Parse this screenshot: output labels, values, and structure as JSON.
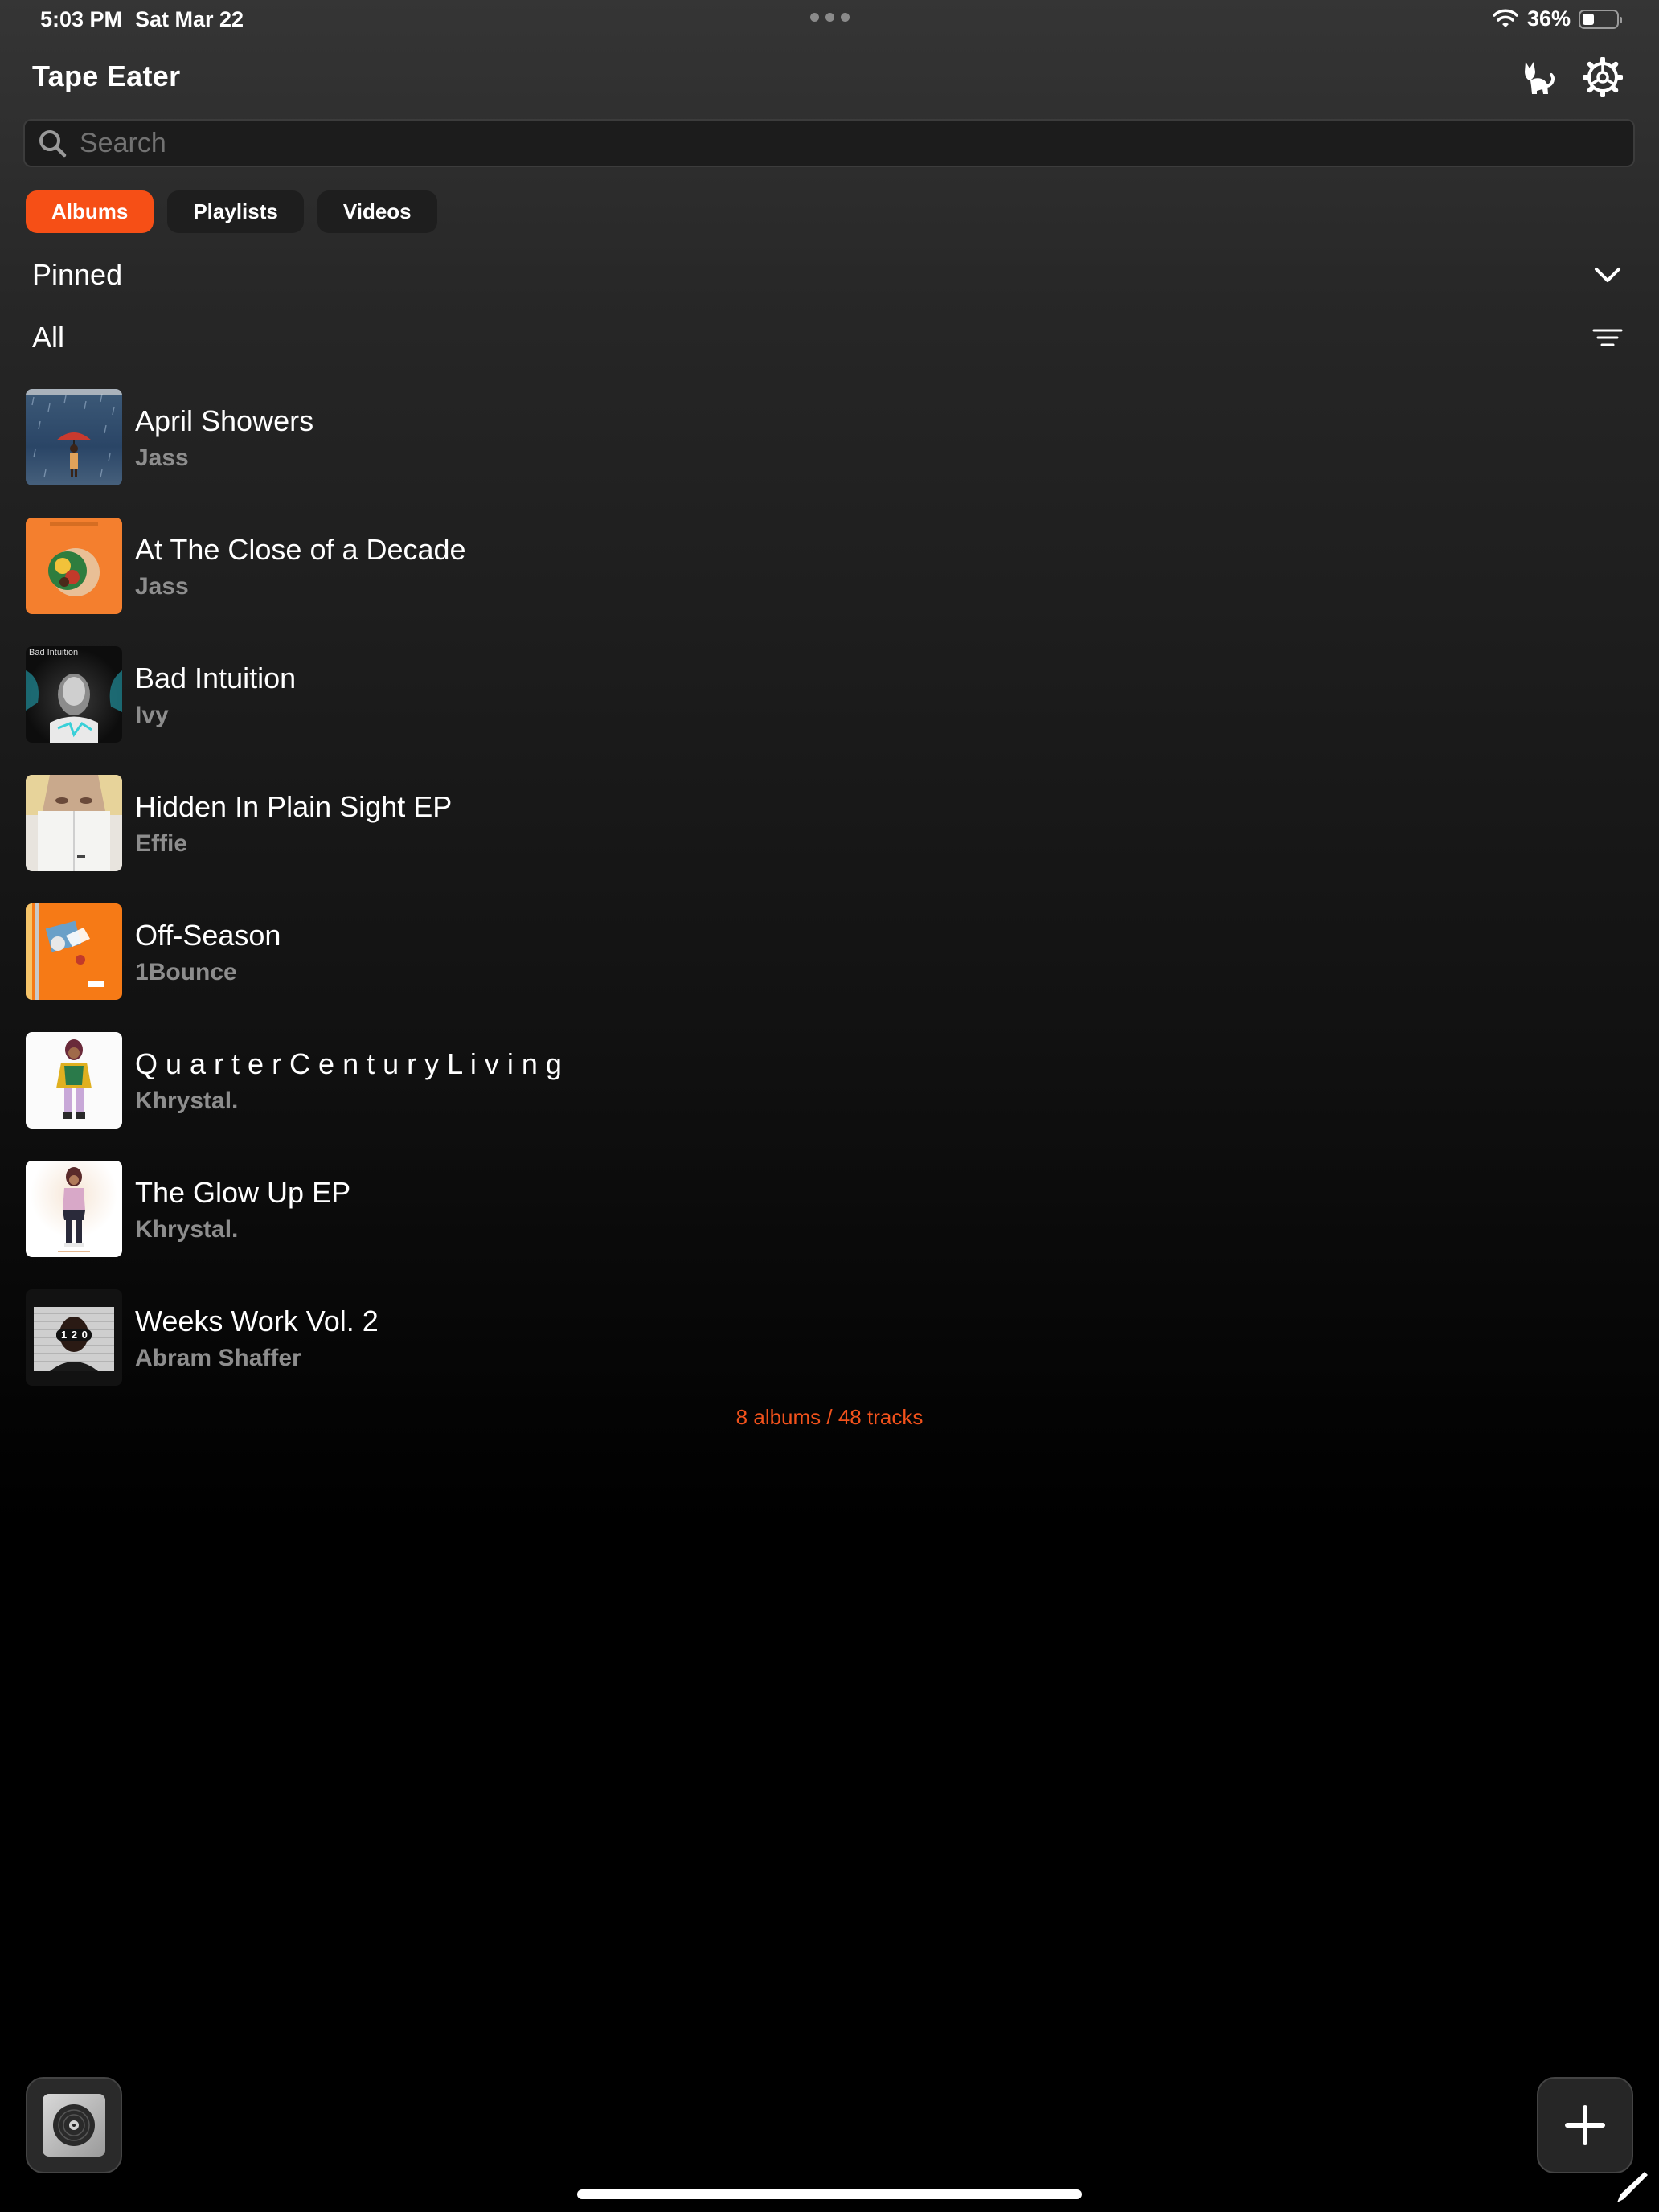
{
  "status_bar": {
    "time": "5:03 PM",
    "date": "Sat Mar 22",
    "battery": "36%",
    "battery_level": 0.36
  },
  "header": {
    "title": "Tape Eater"
  },
  "search": {
    "placeholder": "Search"
  },
  "tabs": [
    {
      "label": "Albums",
      "active": true
    },
    {
      "label": "Playlists",
      "active": false
    },
    {
      "label": "Videos",
      "active": false
    }
  ],
  "sections": {
    "pinned": "Pinned",
    "all": "All"
  },
  "albums": [
    {
      "title": "April Showers",
      "artist": "Jass"
    },
    {
      "title": "At The Close of a Decade",
      "artist": "Jass"
    },
    {
      "title": "Bad Intuition",
      "artist": "Ivy"
    },
    {
      "title": "Hidden In Plain Sight EP",
      "artist": "Effie"
    },
    {
      "title": "Off-Season",
      "artist": "1Bounce"
    },
    {
      "title": "Q u a r t e r C e n t u r y L i v i n g",
      "artist": "Khrystal."
    },
    {
      "title": "The Glow Up EP",
      "artist": "Khrystal."
    },
    {
      "title": "Weeks Work Vol. 2",
      "artist": "Abram Shaffer"
    }
  ],
  "art_text": {
    "bad_intuition": "Bad Intuition",
    "weeks_work": "1 2 0"
  },
  "summary": "8 albums / 48 tracks",
  "colors": {
    "accent": "#f64f16",
    "summary_text": "#f2521c",
    "secondary_text": "#8d8d8d"
  },
  "icons": {
    "header": [
      "cat-icon",
      "gear-icon"
    ],
    "search": "search-icon",
    "pinned": "chevron-down-icon",
    "all": "sort-lines-icon",
    "add": "plus-icon"
  }
}
